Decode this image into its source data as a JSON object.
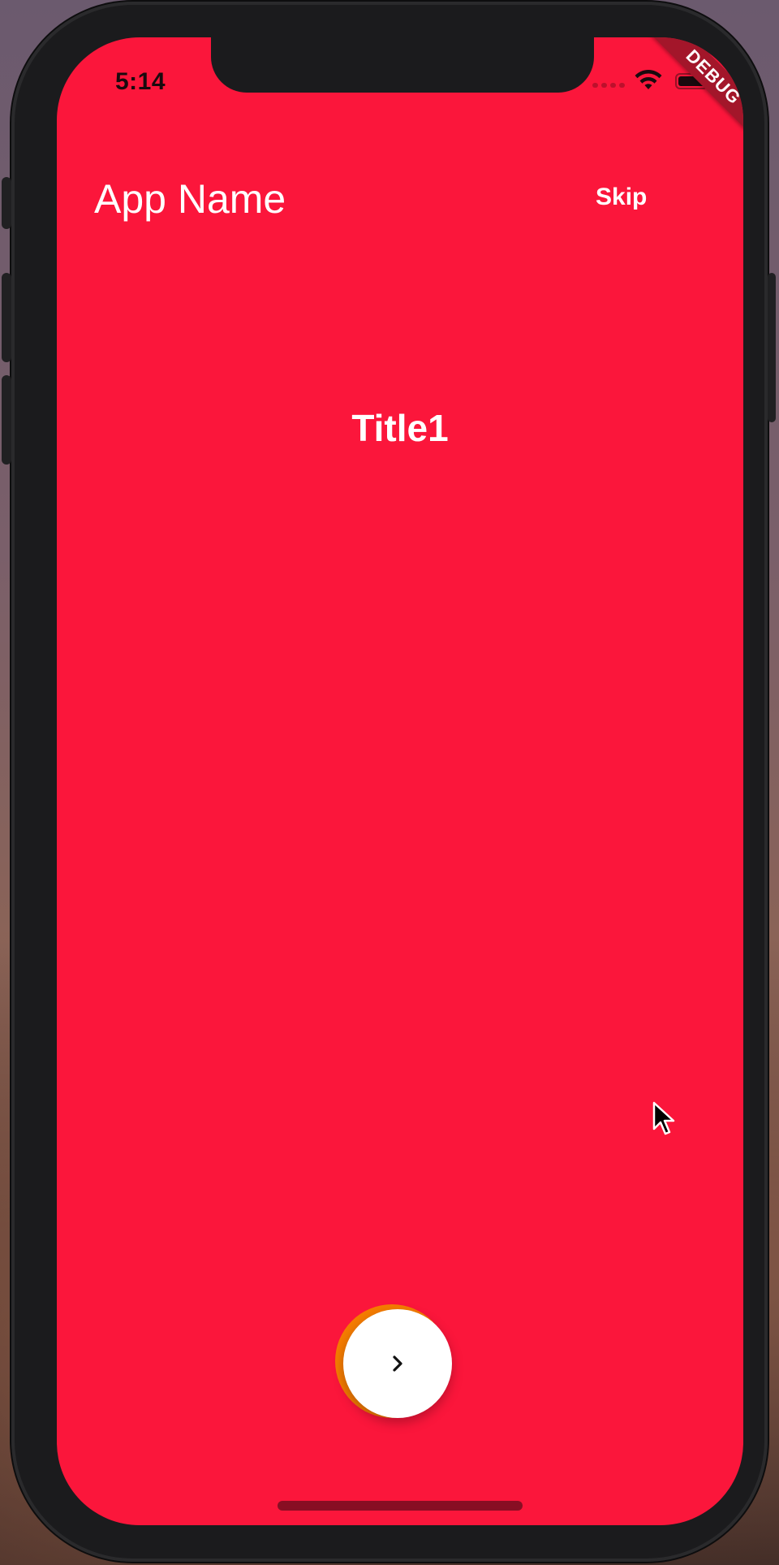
{
  "status_bar": {
    "time": "5:14",
    "wifi_icon": "wifi-icon",
    "battery_icon": "battery-icon"
  },
  "debug_banner": {
    "label": "DEBUG"
  },
  "header": {
    "app_name": "App Name",
    "skip_label": "Skip"
  },
  "onboarding": {
    "title": "Title1",
    "next_icon": "chevron-right-icon"
  },
  "colors": {
    "background": "#fb163b",
    "progress_ring": "#f57c00",
    "button": "#ffffff"
  }
}
